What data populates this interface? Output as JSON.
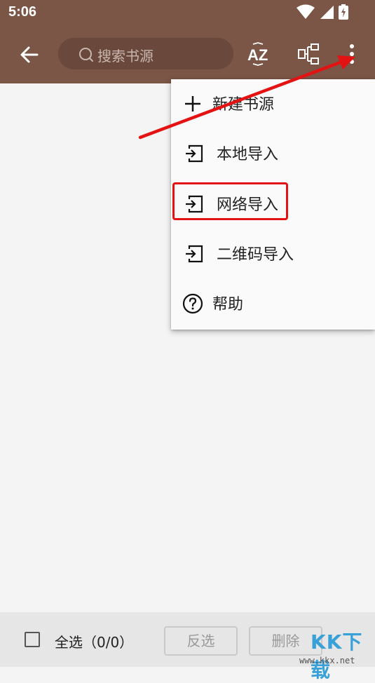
{
  "status_bar": {
    "time": "5:06"
  },
  "toolbar": {
    "search_placeholder": "搜索书源",
    "sort_icon": "sort-az-icon",
    "group_icon": "group-icon",
    "more_icon": "more-vert-icon",
    "color": "#7b5546"
  },
  "menu": {
    "items": [
      {
        "label": "新建书源",
        "icon": "plus-icon"
      },
      {
        "label": "本地导入",
        "icon": "import-icon"
      },
      {
        "label": "网络导入",
        "icon": "import-icon",
        "highlighted": true
      },
      {
        "label": "二维码导入",
        "icon": "import-icon"
      },
      {
        "label": "帮助",
        "icon": "help-icon"
      }
    ]
  },
  "bottom_bar": {
    "select_all_label": "全选（0/0）",
    "invert_label": "反选",
    "delete_label": "删除"
  },
  "watermark": {
    "text": "KK下载",
    "url": "www.kkx.net"
  },
  "annotation": {
    "arrow_color": "#e31313",
    "box_color": "#e31313"
  }
}
